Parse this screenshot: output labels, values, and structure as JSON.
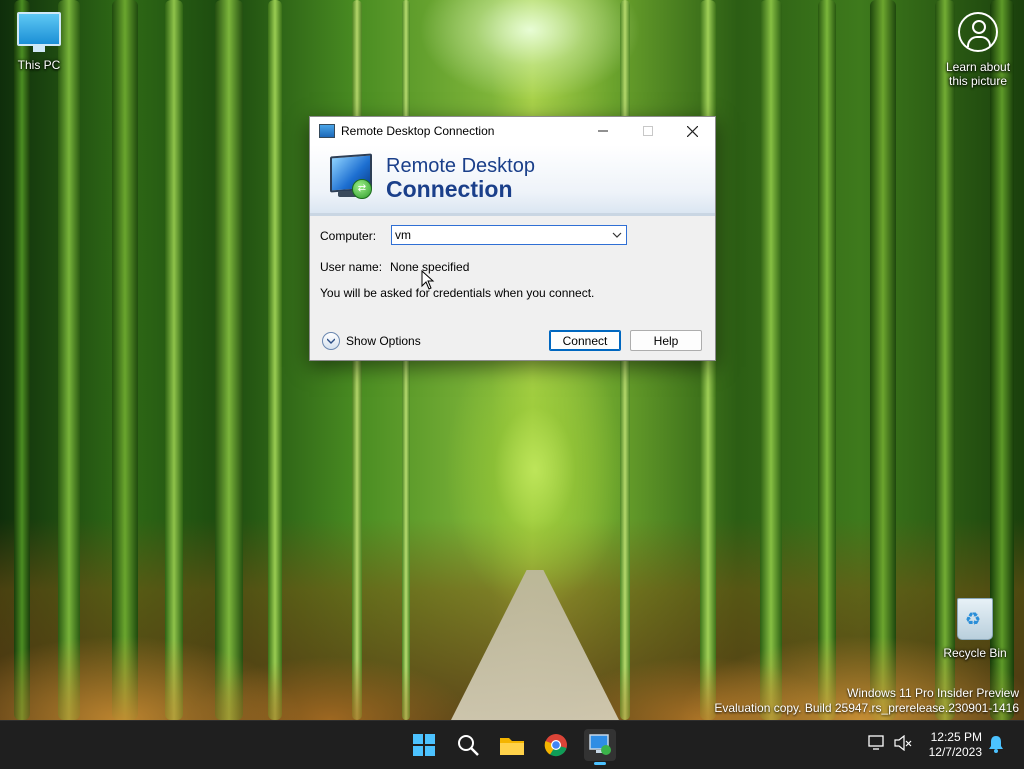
{
  "desktop": {
    "icons": [
      {
        "name": "this-pc",
        "label": "This PC"
      },
      {
        "name": "recycle-bin",
        "label": "Recycle Bin"
      }
    ],
    "spotlight": {
      "line1": "Learn about",
      "line2": "this picture"
    },
    "watermark": {
      "line1": "Windows 11 Pro Insider Preview",
      "line2": "Evaluation copy. Build 25947.rs_prerelease.230901-1416"
    }
  },
  "dialog": {
    "title": "Remote Desktop Connection",
    "banner_line1": "Remote Desktop",
    "banner_line2": "Connection",
    "computer_label": "Computer:",
    "computer_value": "vm",
    "username_label": "User name:",
    "username_value": "None specified",
    "info_text": "You will be asked for credentials when you connect.",
    "show_options": "Show Options",
    "connect_button": "Connect",
    "help_button": "Help",
    "window_controls": {
      "minimize": "—",
      "maximize": "☐",
      "close": "✕"
    }
  },
  "taskbar": {
    "apps": [
      "start-icon",
      "search-icon",
      "file-explorer-icon",
      "chrome-icon",
      "remote-desktop-icon"
    ],
    "active_app": "remote-desktop-icon",
    "clock": {
      "time": "12:25 PM",
      "date": "12/7/2023"
    },
    "accent_color": "#4cc2ff"
  }
}
